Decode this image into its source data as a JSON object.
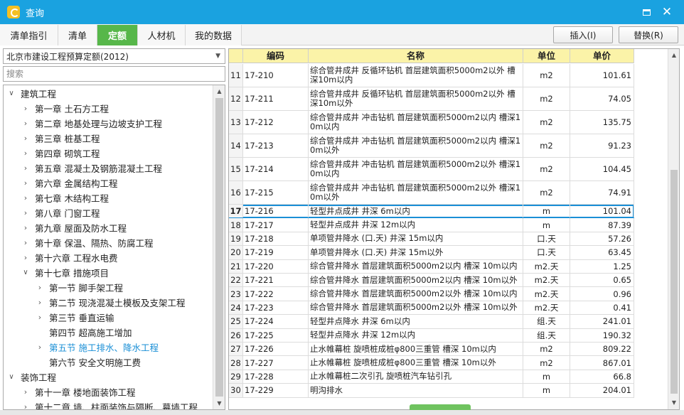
{
  "window": {
    "title": "查询"
  },
  "tabs": [
    {
      "label": "清单指引",
      "active": false
    },
    {
      "label": "清单",
      "active": false
    },
    {
      "label": "定额",
      "active": true
    },
    {
      "label": "人材机",
      "active": false
    },
    {
      "label": "我的数据",
      "active": false
    }
  ],
  "actions": {
    "insert": "插入(I)",
    "replace": "替换(R)"
  },
  "left": {
    "quota_select": "北京市建设工程预算定额(2012)",
    "search_placeholder": "搜索",
    "tree": [
      {
        "level": 0,
        "chev": "expanded",
        "label": "建筑工程"
      },
      {
        "level": 1,
        "chev": "collapsed",
        "label": "第一章 土石方工程"
      },
      {
        "level": 1,
        "chev": "collapsed",
        "label": "第二章 地基处理与边坡支护工程"
      },
      {
        "level": 1,
        "chev": "collapsed",
        "label": "第三章 桩基工程"
      },
      {
        "level": 1,
        "chev": "collapsed",
        "label": "第四章 砌筑工程"
      },
      {
        "level": 1,
        "chev": "collapsed",
        "label": "第五章 混凝土及钢筋混凝土工程"
      },
      {
        "level": 1,
        "chev": "collapsed",
        "label": "第六章 金属结构工程"
      },
      {
        "level": 1,
        "chev": "collapsed",
        "label": "第七章 木结构工程"
      },
      {
        "level": 1,
        "chev": "collapsed",
        "label": "第八章 门窗工程"
      },
      {
        "level": 1,
        "chev": "collapsed",
        "label": "第九章 屋面及防水工程"
      },
      {
        "level": 1,
        "chev": "collapsed",
        "label": "第十章 保温、隔热、防腐工程"
      },
      {
        "level": 1,
        "chev": "collapsed",
        "label": "第十六章 工程水电费"
      },
      {
        "level": 1,
        "chev": "expanded",
        "label": "第十七章 措施项目"
      },
      {
        "level": 2,
        "chev": "collapsed",
        "label": "第一节 脚手架工程"
      },
      {
        "level": 2,
        "chev": "collapsed",
        "label": "第二节 现浇混凝土模板及支架工程"
      },
      {
        "level": 2,
        "chev": "collapsed",
        "label": "第三节 垂直运输"
      },
      {
        "level": 2,
        "chev": "none",
        "label": "第四节 超高施工增加"
      },
      {
        "level": 2,
        "chev": "collapsed",
        "label": "第五节 施工排水、降水工程",
        "selected": true
      },
      {
        "level": 2,
        "chev": "none",
        "label": "第六节 安全文明施工费"
      },
      {
        "level": 0,
        "chev": "expanded",
        "label": "装饰工程"
      },
      {
        "level": 1,
        "chev": "collapsed",
        "label": "第十一章 楼地面装饰工程"
      },
      {
        "level": 1,
        "chev": "collapsed",
        "label": "第十二章 墙、柱面装饰与隔断、幕墙工程"
      }
    ]
  },
  "table": {
    "headers": {
      "code": "编码",
      "name": "名称",
      "unit": "单位",
      "price": "单价"
    },
    "rows": [
      {
        "idx": "11",
        "code": "17-210",
        "name": "综合管井成井 反循环钻机 首层建筑面积5000m2以外 槽深10m以内",
        "unit": "m2",
        "price": "101.61",
        "tall": true
      },
      {
        "idx": "12",
        "code": "17-211",
        "name": "综合管井成井 反循环钻机 首层建筑面积5000m2以外 槽深10m以外",
        "unit": "m2",
        "price": "74.05",
        "tall": true
      },
      {
        "idx": "13",
        "code": "17-212",
        "name": "综合管井成井 冲击钻机 首层建筑面积5000m2以内 槽深10m以内",
        "unit": "m2",
        "price": "135.75",
        "tall": true
      },
      {
        "idx": "14",
        "code": "17-213",
        "name": "综合管井成井 冲击钻机 首层建筑面积5000m2以内 槽深10m以外",
        "unit": "m2",
        "price": "91.23",
        "tall": true
      },
      {
        "idx": "15",
        "code": "17-214",
        "name": "综合管井成井 冲击钻机 首层建筑面积5000m2以外 槽深10m以内",
        "unit": "m2",
        "price": "104.45",
        "tall": true
      },
      {
        "idx": "16",
        "code": "17-215",
        "name": "综合管井成井 冲击钻机 首层建筑面积5000m2以外 槽深10m以外",
        "unit": "m2",
        "price": "74.91",
        "tall": true
      },
      {
        "idx": "17",
        "code": "17-216",
        "name": "轻型井点成井 井深 6m以内",
        "unit": "m",
        "price": "101.04",
        "selected": true
      },
      {
        "idx": "18",
        "code": "17-217",
        "name": "轻型井点成井 井深 12m以内",
        "unit": "m",
        "price": "87.39"
      },
      {
        "idx": "19",
        "code": "17-218",
        "name": "单项管井降水 (口.天) 井深 15m以内",
        "unit": "口.天",
        "price": "57.26"
      },
      {
        "idx": "20",
        "code": "17-219",
        "name": "单项管井降水 (口.天) 井深 15m以外",
        "unit": "口.天",
        "price": "63.45"
      },
      {
        "idx": "21",
        "code": "17-220",
        "name": "综合管井降水 首层建筑面积5000m2以内 槽深 10m以内",
        "unit": "m2.天",
        "price": "1.25"
      },
      {
        "idx": "22",
        "code": "17-221",
        "name": "综合管井降水 首层建筑面积5000m2以内 槽深 10m以外",
        "unit": "m2.天",
        "price": "0.65"
      },
      {
        "idx": "23",
        "code": "17-222",
        "name": "综合管井降水 首层建筑面积5000m2以外 槽深 10m以内",
        "unit": "m2.天",
        "price": "0.96"
      },
      {
        "idx": "24",
        "code": "17-223",
        "name": "综合管井降水 首层建筑面积5000m2以外 槽深 10m以外",
        "unit": "m2.天",
        "price": "0.41"
      },
      {
        "idx": "25",
        "code": "17-224",
        "name": "轻型井点降水 井深 6m以内",
        "unit": "组.天",
        "price": "241.01"
      },
      {
        "idx": "26",
        "code": "17-225",
        "name": "轻型井点降水 井深 12m以内",
        "unit": "组.天",
        "price": "190.32"
      },
      {
        "idx": "27",
        "code": "17-226",
        "name": "止水帷幕桩 旋喷桩成桩φ800三重管 槽深 10m以内",
        "unit": "m2",
        "price": "809.22"
      },
      {
        "idx": "28",
        "code": "17-227",
        "name": "止水帷幕桩 旋喷桩成桩φ800三重管 槽深 10m以外",
        "unit": "m2",
        "price": "867.01"
      },
      {
        "idx": "29",
        "code": "17-228",
        "name": "止水帷幕桩二次引孔 旋喷桩汽车钻引孔",
        "unit": "m",
        "price": "66.8"
      },
      {
        "idx": "30",
        "code": "17-229",
        "name": "明沟排水",
        "unit": "m",
        "price": "204.01"
      }
    ]
  }
}
